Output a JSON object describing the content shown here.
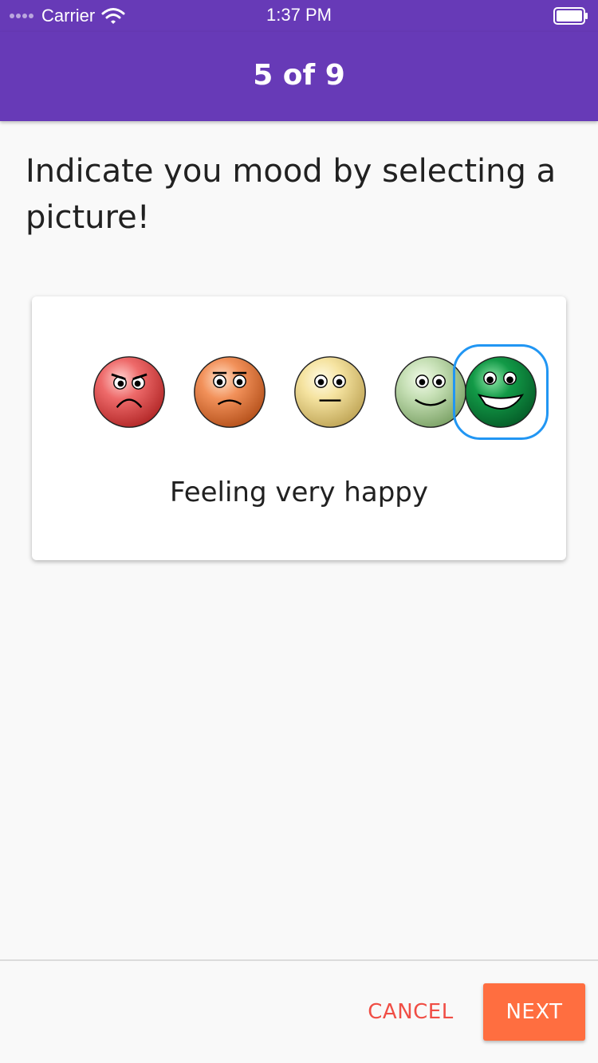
{
  "status_bar": {
    "carrier": "Carrier",
    "time": "1:37 PM",
    "signal_icon": "signal-dots-icon",
    "wifi_icon": "wifi-icon",
    "battery_icon": "battery-icon"
  },
  "app_bar": {
    "title": "5 of 9",
    "background_color": "#673ab7"
  },
  "question": {
    "text": "Indicate you mood by selecting a picture!"
  },
  "mood_card": {
    "options": [
      {
        "icon": "angry-face-icon",
        "color": "#ee6a6a",
        "selected": false
      },
      {
        "icon": "sad-face-icon",
        "color": "#f2915a",
        "selected": false
      },
      {
        "icon": "neutral-face-icon",
        "color": "#f5e3a0",
        "selected": false
      },
      {
        "icon": "happy-face-icon",
        "color": "#c5dfb4",
        "selected": false
      },
      {
        "icon": "very-happy-face-icon",
        "color": "#129a47",
        "selected": true
      }
    ],
    "selected_label": "Feeling very happy",
    "selection_color": "#2196f3"
  },
  "footer": {
    "cancel_label": "CANCEL",
    "next_label": "NEXT",
    "cancel_color": "#f04e45",
    "next_color": "#ff6e40"
  }
}
